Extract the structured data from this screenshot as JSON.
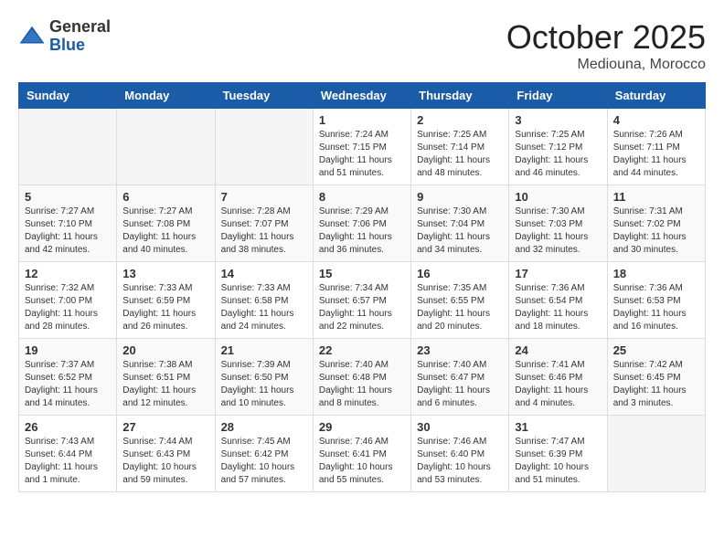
{
  "logo": {
    "general": "General",
    "blue": "Blue"
  },
  "header": {
    "month": "October 2025",
    "location": "Mediouna, Morocco"
  },
  "weekdays": [
    "Sunday",
    "Monday",
    "Tuesday",
    "Wednesday",
    "Thursday",
    "Friday",
    "Saturday"
  ],
  "weeks": [
    [
      {
        "day": "",
        "info": ""
      },
      {
        "day": "",
        "info": ""
      },
      {
        "day": "",
        "info": ""
      },
      {
        "day": "1",
        "info": "Sunrise: 7:24 AM\nSunset: 7:15 PM\nDaylight: 11 hours\nand 51 minutes."
      },
      {
        "day": "2",
        "info": "Sunrise: 7:25 AM\nSunset: 7:14 PM\nDaylight: 11 hours\nand 48 minutes."
      },
      {
        "day": "3",
        "info": "Sunrise: 7:25 AM\nSunset: 7:12 PM\nDaylight: 11 hours\nand 46 minutes."
      },
      {
        "day": "4",
        "info": "Sunrise: 7:26 AM\nSunset: 7:11 PM\nDaylight: 11 hours\nand 44 minutes."
      }
    ],
    [
      {
        "day": "5",
        "info": "Sunrise: 7:27 AM\nSunset: 7:10 PM\nDaylight: 11 hours\nand 42 minutes."
      },
      {
        "day": "6",
        "info": "Sunrise: 7:27 AM\nSunset: 7:08 PM\nDaylight: 11 hours\nand 40 minutes."
      },
      {
        "day": "7",
        "info": "Sunrise: 7:28 AM\nSunset: 7:07 PM\nDaylight: 11 hours\nand 38 minutes."
      },
      {
        "day": "8",
        "info": "Sunrise: 7:29 AM\nSunset: 7:06 PM\nDaylight: 11 hours\nand 36 minutes."
      },
      {
        "day": "9",
        "info": "Sunrise: 7:30 AM\nSunset: 7:04 PM\nDaylight: 11 hours\nand 34 minutes."
      },
      {
        "day": "10",
        "info": "Sunrise: 7:30 AM\nSunset: 7:03 PM\nDaylight: 11 hours\nand 32 minutes."
      },
      {
        "day": "11",
        "info": "Sunrise: 7:31 AM\nSunset: 7:02 PM\nDaylight: 11 hours\nand 30 minutes."
      }
    ],
    [
      {
        "day": "12",
        "info": "Sunrise: 7:32 AM\nSunset: 7:00 PM\nDaylight: 11 hours\nand 28 minutes."
      },
      {
        "day": "13",
        "info": "Sunrise: 7:33 AM\nSunset: 6:59 PM\nDaylight: 11 hours\nand 26 minutes."
      },
      {
        "day": "14",
        "info": "Sunrise: 7:33 AM\nSunset: 6:58 PM\nDaylight: 11 hours\nand 24 minutes."
      },
      {
        "day": "15",
        "info": "Sunrise: 7:34 AM\nSunset: 6:57 PM\nDaylight: 11 hours\nand 22 minutes."
      },
      {
        "day": "16",
        "info": "Sunrise: 7:35 AM\nSunset: 6:55 PM\nDaylight: 11 hours\nand 20 minutes."
      },
      {
        "day": "17",
        "info": "Sunrise: 7:36 AM\nSunset: 6:54 PM\nDaylight: 11 hours\nand 18 minutes."
      },
      {
        "day": "18",
        "info": "Sunrise: 7:36 AM\nSunset: 6:53 PM\nDaylight: 11 hours\nand 16 minutes."
      }
    ],
    [
      {
        "day": "19",
        "info": "Sunrise: 7:37 AM\nSunset: 6:52 PM\nDaylight: 11 hours\nand 14 minutes."
      },
      {
        "day": "20",
        "info": "Sunrise: 7:38 AM\nSunset: 6:51 PM\nDaylight: 11 hours\nand 12 minutes."
      },
      {
        "day": "21",
        "info": "Sunrise: 7:39 AM\nSunset: 6:50 PM\nDaylight: 11 hours\nand 10 minutes."
      },
      {
        "day": "22",
        "info": "Sunrise: 7:40 AM\nSunset: 6:48 PM\nDaylight: 11 hours\nand 8 minutes."
      },
      {
        "day": "23",
        "info": "Sunrise: 7:40 AM\nSunset: 6:47 PM\nDaylight: 11 hours\nand 6 minutes."
      },
      {
        "day": "24",
        "info": "Sunrise: 7:41 AM\nSunset: 6:46 PM\nDaylight: 11 hours\nand 4 minutes."
      },
      {
        "day": "25",
        "info": "Sunrise: 7:42 AM\nSunset: 6:45 PM\nDaylight: 11 hours\nand 3 minutes."
      }
    ],
    [
      {
        "day": "26",
        "info": "Sunrise: 7:43 AM\nSunset: 6:44 PM\nDaylight: 11 hours\nand 1 minute."
      },
      {
        "day": "27",
        "info": "Sunrise: 7:44 AM\nSunset: 6:43 PM\nDaylight: 10 hours\nand 59 minutes."
      },
      {
        "day": "28",
        "info": "Sunrise: 7:45 AM\nSunset: 6:42 PM\nDaylight: 10 hours\nand 57 minutes."
      },
      {
        "day": "29",
        "info": "Sunrise: 7:46 AM\nSunset: 6:41 PM\nDaylight: 10 hours\nand 55 minutes."
      },
      {
        "day": "30",
        "info": "Sunrise: 7:46 AM\nSunset: 6:40 PM\nDaylight: 10 hours\nand 53 minutes."
      },
      {
        "day": "31",
        "info": "Sunrise: 7:47 AM\nSunset: 6:39 PM\nDaylight: 10 hours\nand 51 minutes."
      },
      {
        "day": "",
        "info": ""
      }
    ]
  ]
}
